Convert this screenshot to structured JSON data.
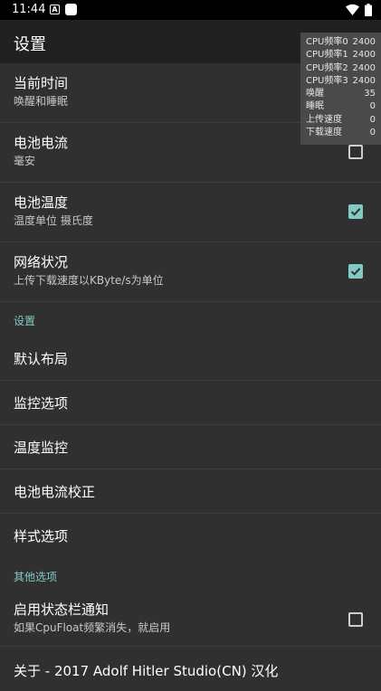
{
  "status_bar": {
    "time": "11:44",
    "notif_icon": "A"
  },
  "appbar": {
    "title": "设置"
  },
  "rows": [
    {
      "title": "当前时间",
      "subtitle": "唤醒和睡眠"
    },
    {
      "title": "电池电流",
      "subtitle": "毫安",
      "checked": false
    },
    {
      "title": "电池温度",
      "subtitle": "温度单位 摄氏度",
      "checked": true
    },
    {
      "title": "网络状况",
      "subtitle": "上传下载速度以KByte/s为单位",
      "checked": true
    }
  ],
  "section_settings": {
    "header": "设置",
    "items": [
      "默认布局",
      "监控选项",
      "温度监控",
      "电池电流校正",
      "样式选项"
    ]
  },
  "section_other": {
    "header": "其他选项"
  },
  "status_notification": {
    "title": "启用状态栏通知",
    "subtitle": "如果CpuFloat频繁消失，就启用",
    "checked": false
  },
  "about": {
    "title": "关于 - 2017 Adolf Hitler Studio(CN) 汉化"
  },
  "overlay": [
    {
      "label": "CPU频率0",
      "value": "2400"
    },
    {
      "label": "CPU频率1",
      "value": "2400"
    },
    {
      "label": "CPU频率2",
      "value": "2400"
    },
    {
      "label": "CPU频率3",
      "value": "2400"
    },
    {
      "label": "唤醒",
      "value": "35"
    },
    {
      "label": "睡眠",
      "value": "0"
    },
    {
      "label": "上传速度",
      "value": "0"
    },
    {
      "label": "下载速度",
      "value": "0"
    }
  ],
  "colors": {
    "accent": "#80cbc4",
    "background": "#303030",
    "appbar": "#212121"
  }
}
